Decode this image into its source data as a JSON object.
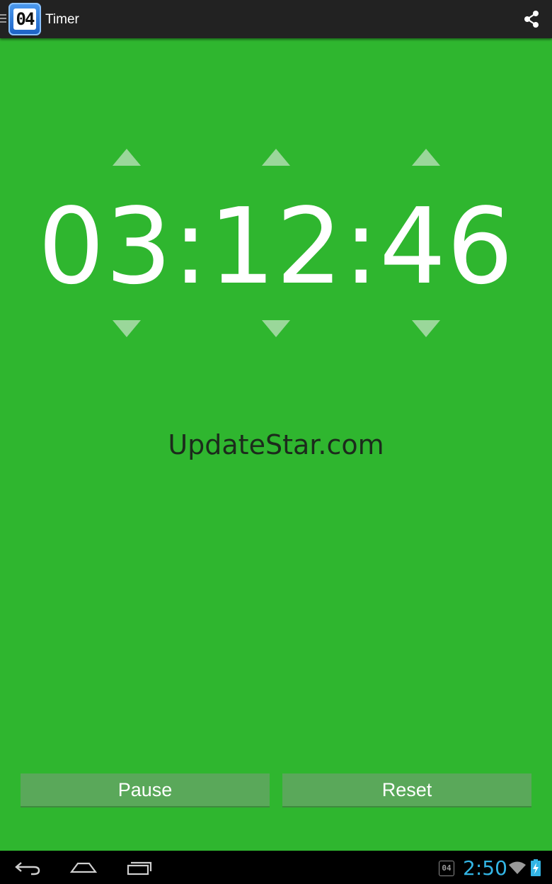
{
  "action_bar": {
    "app_icon": "stopwatch-app-icon",
    "app_icon_text": "04",
    "title": "Timer",
    "share_icon": "share-icon"
  },
  "timer": {
    "display": "03:12:46",
    "hours": "03",
    "minutes": "12",
    "seconds": "46",
    "up_icon": "triangle-up-icon",
    "down_icon": "triangle-down-icon"
  },
  "watermark": "UpdateStar.com",
  "buttons": {
    "pause_label": "Pause",
    "reset_label": "Reset"
  },
  "system_bar": {
    "back_icon": "back-icon",
    "home_icon": "home-icon",
    "recents_icon": "recents-icon",
    "notification_icon": "timer-notification-icon",
    "notification_text": "04",
    "clock": "2:50",
    "wifi_icon": "wifi-icon",
    "battery_icon": "battery-charging-icon"
  },
  "colors": {
    "background": "#2fb62f",
    "action_bar": "#222222",
    "button": "#5aa85a",
    "clock_accent": "#33b5e5"
  }
}
